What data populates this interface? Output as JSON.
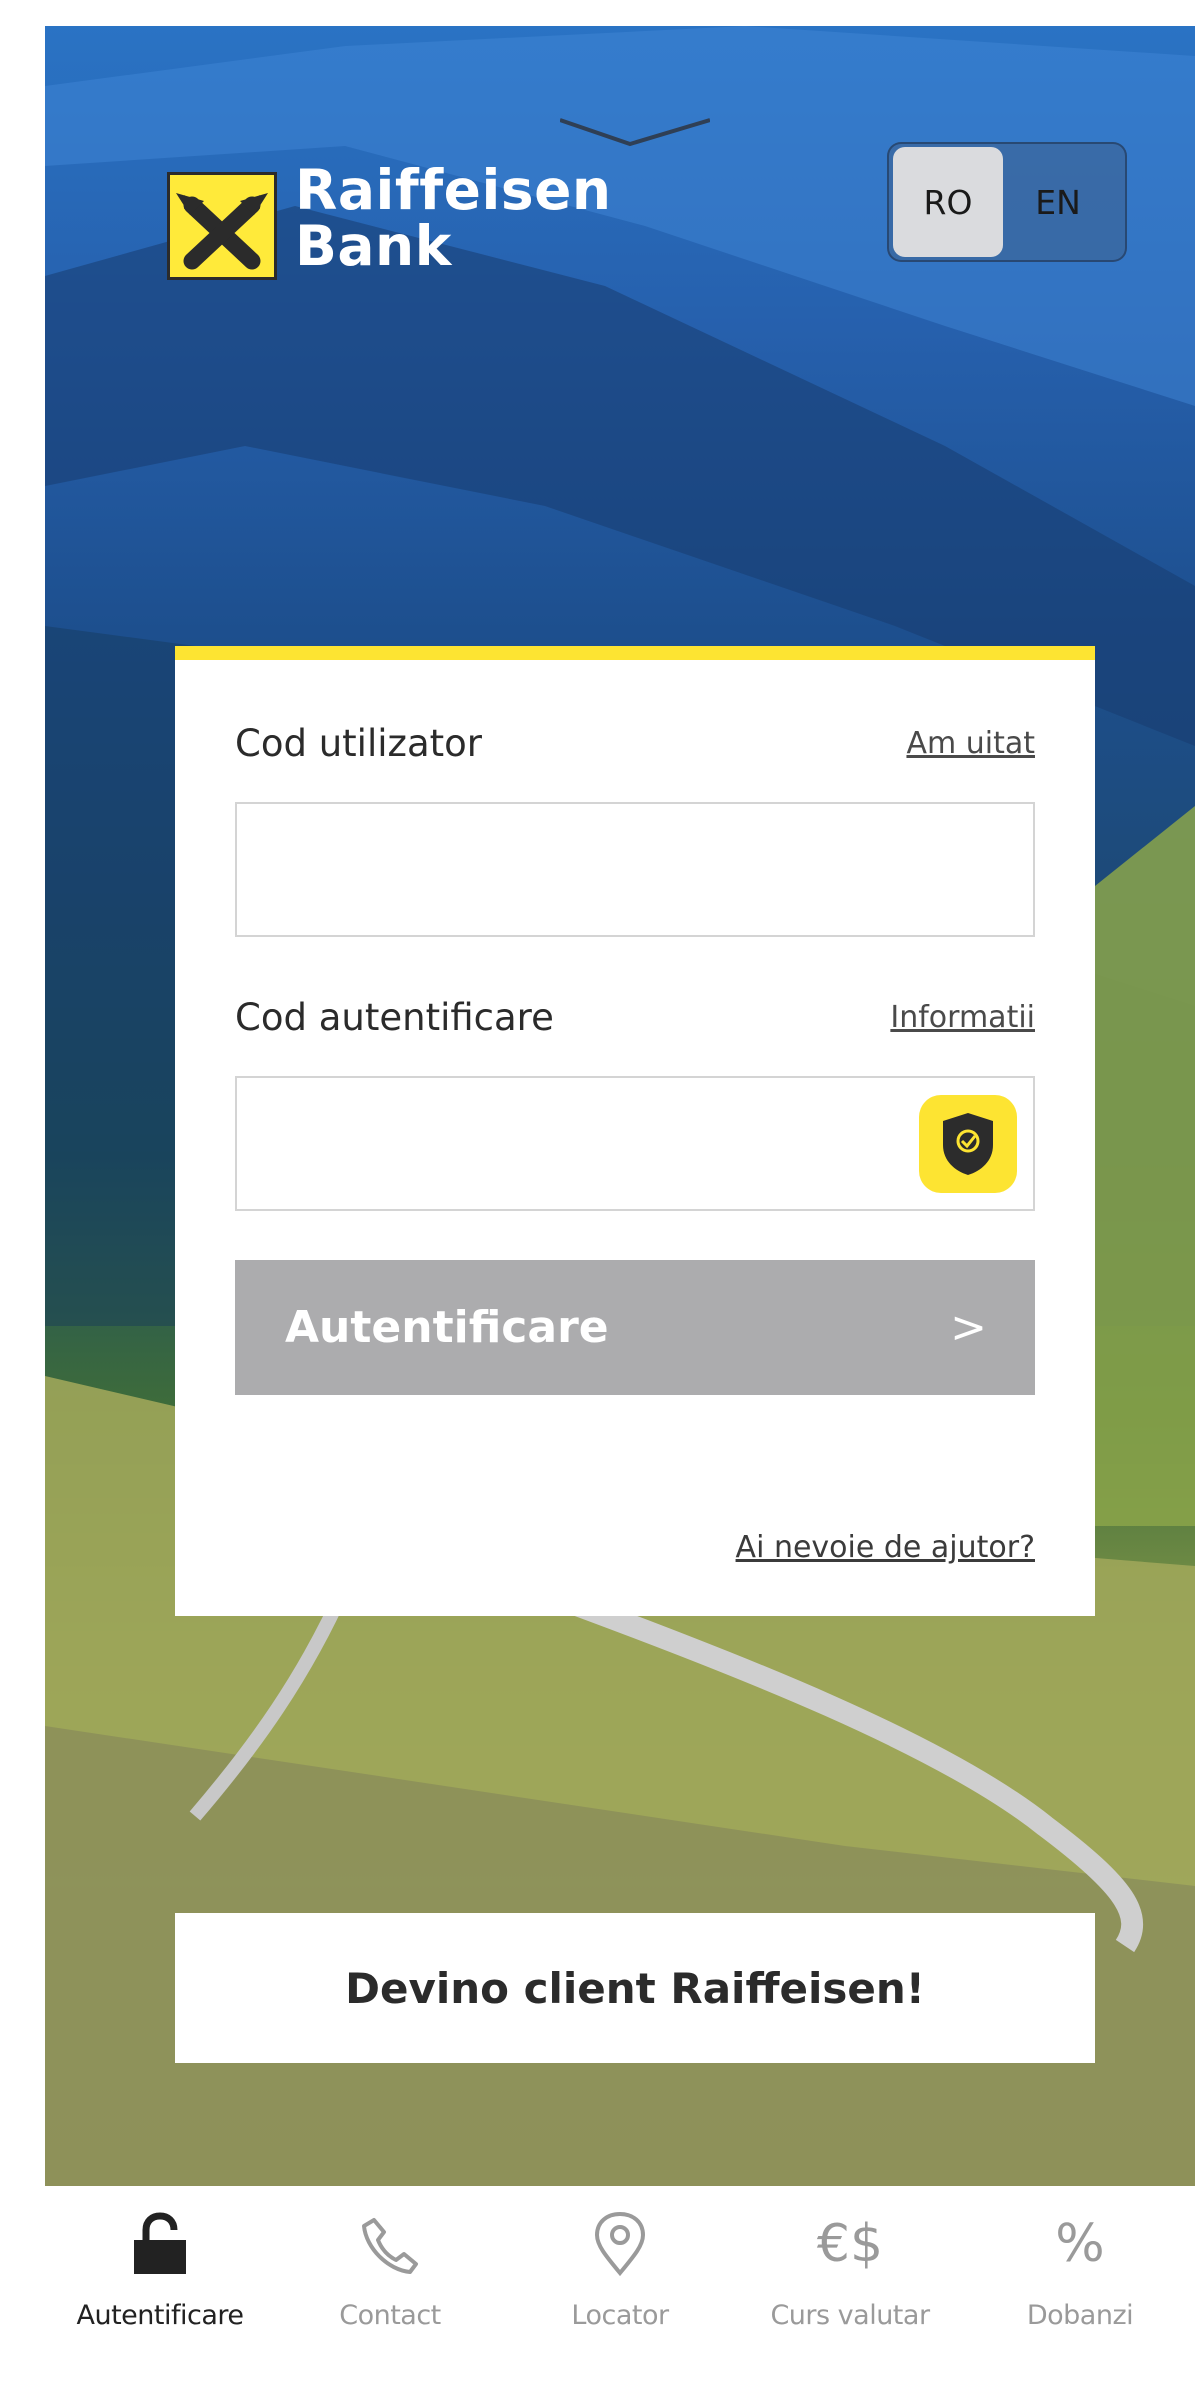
{
  "brand": {
    "name_line1": "Raiffeisen",
    "name_line2": "Bank",
    "logo_color": "#fde432"
  },
  "language_switch": {
    "options": [
      "RO",
      "EN"
    ],
    "selected": "RO"
  },
  "login": {
    "username_label": "Cod utilizator",
    "forgot_link": "Am uitat",
    "username_value": "",
    "auth_label": "Cod autentificare",
    "info_link": "Informatii",
    "auth_value": "",
    "auth_icon": "shield-check-icon",
    "submit_label": "Autentificare",
    "submit_chevron": ">",
    "help_link": "Ai nevoie de ajutor?"
  },
  "become_client": {
    "label": "Devino client Raiffeisen!"
  },
  "bottom_nav": {
    "items": [
      {
        "label": "Autentificare",
        "icon": "lock-icon",
        "active": true
      },
      {
        "label": "Contact",
        "icon": "phone-icon",
        "active": false
      },
      {
        "label": "Locator",
        "icon": "location-pin-icon",
        "active": false
      },
      {
        "label": "Curs valutar",
        "icon": "currency-icon",
        "glyph": "€$",
        "active": false
      },
      {
        "label": "Dobanzi",
        "icon": "percent-icon",
        "glyph": "%",
        "active": false
      }
    ]
  },
  "colors": {
    "accent_yellow": "#fde432",
    "button_disabled": "#acacae"
  }
}
